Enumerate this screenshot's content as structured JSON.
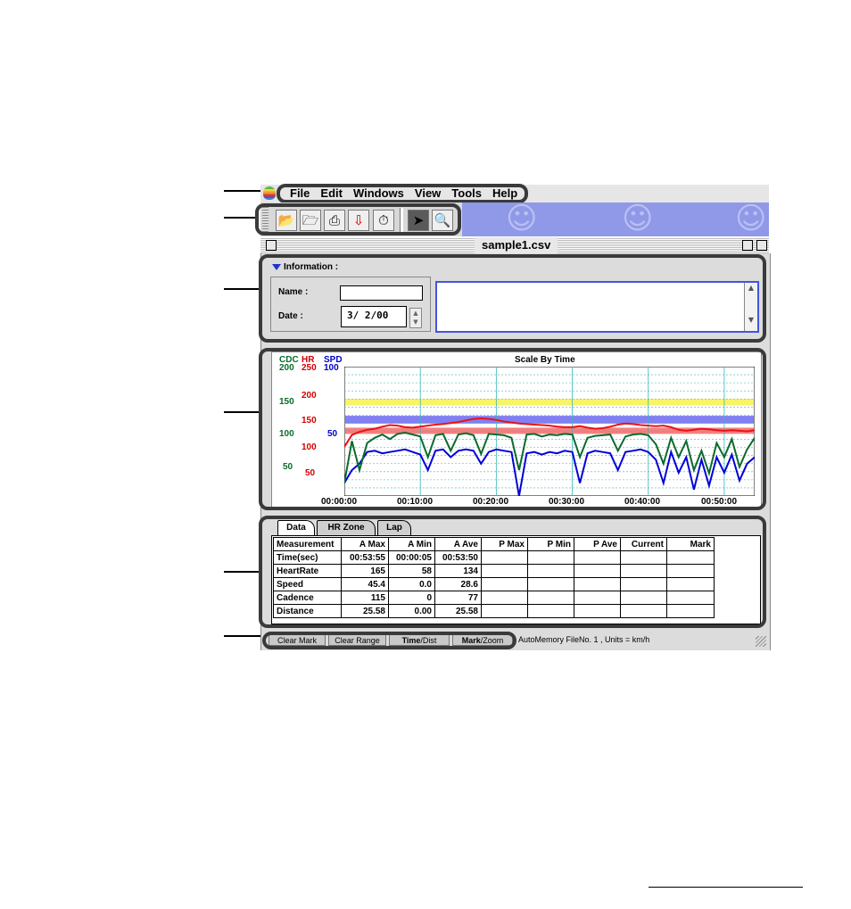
{
  "menubar": {
    "items": [
      "File",
      "Edit",
      "Windows",
      "View",
      "Tools",
      "Help"
    ]
  },
  "toolbar": {
    "buttons": [
      "open-folder-icon",
      "new-folder-icon",
      "print-icon",
      "download-icon",
      "stopwatch-icon",
      "pointer-icon",
      "zoom-icon"
    ]
  },
  "window": {
    "title": "sample1.csv"
  },
  "information": {
    "header": "Information :",
    "name_label": "Name :",
    "name_value": "",
    "date_label": "Date :",
    "date_value": "3/ 2/00"
  },
  "chart_data": {
    "type": "line",
    "title": "Scale By Time",
    "axes": {
      "cdc": {
        "label": "CDC",
        "ticks": [
          "200",
          "150",
          "100",
          "50"
        ],
        "color": "#0a6b2c"
      },
      "hr": {
        "label": "HR",
        "ticks": [
          "250",
          "200",
          "150",
          "100",
          "50"
        ],
        "color": "#d40000"
      },
      "spd": {
        "label": "SPD",
        "ticks": [
          "100",
          "50"
        ],
        "color": "#0000c8"
      }
    },
    "x_ticks": [
      "00:00:00",
      "00:10:00",
      "00:20:00",
      "00:30:00",
      "00:40:00",
      "00:50:00"
    ],
    "series": [
      {
        "name": "HR",
        "color": "#ee1111",
        "ylim": [
          0,
          250
        ],
        "x": [
          0,
          1,
          2,
          3,
          4,
          5,
          6,
          7,
          8,
          9,
          10,
          11,
          12,
          13,
          14,
          15,
          16,
          17,
          18,
          19,
          20,
          21,
          22,
          23,
          24,
          25,
          26,
          27,
          28,
          29,
          30,
          31,
          32,
          33,
          34,
          35,
          36,
          37,
          38,
          39,
          40,
          41,
          42,
          43,
          44,
          45,
          46,
          47,
          48,
          49,
          50,
          51,
          52,
          53,
          54
        ],
        "values": [
          95,
          118,
          124,
          128,
          130,
          134,
          137,
          136,
          133,
          132,
          134,
          136,
          138,
          139,
          141,
          143,
          146,
          149,
          150,
          149,
          147,
          144,
          142,
          140,
          139,
          138,
          137,
          136,
          134,
          133,
          133,
          135,
          132,
          130,
          131,
          134,
          138,
          140,
          139,
          137,
          136,
          135,
          136,
          133,
          128,
          126,
          128,
          130,
          129,
          127,
          126,
          127,
          126,
          125,
          127
        ]
      },
      {
        "name": "CDC",
        "color": "#0a6b2c",
        "ylim": [
          0,
          200
        ],
        "x": [
          0,
          1,
          2,
          3,
          4,
          5,
          6,
          7,
          8,
          9,
          10,
          11,
          12,
          13,
          14,
          15,
          16,
          17,
          18,
          19,
          20,
          21,
          22,
          23,
          24,
          25,
          26,
          27,
          28,
          29,
          30,
          31,
          32,
          33,
          34,
          35,
          36,
          37,
          38,
          39,
          40,
          41,
          42,
          43,
          44,
          45,
          46,
          47,
          48,
          49,
          50,
          51,
          52,
          53,
          54
        ],
        "values": [
          20,
          85,
          40,
          82,
          90,
          95,
          88,
          96,
          98,
          95,
          92,
          60,
          94,
          96,
          70,
          95,
          97,
          94,
          65,
          96,
          95,
          94,
          90,
          40,
          95,
          96,
          92,
          95,
          94,
          96,
          95,
          60,
          90,
          93,
          94,
          95,
          70,
          92,
          95,
          96,
          94,
          80,
          50,
          90,
          60,
          85,
          40,
          70,
          35,
          82,
          60,
          88,
          45,
          72,
          90
        ]
      },
      {
        "name": "SPD",
        "color": "#0000d8",
        "ylim": [
          0,
          100
        ],
        "x": [
          0,
          1,
          2,
          3,
          4,
          5,
          6,
          7,
          8,
          9,
          10,
          11,
          12,
          13,
          14,
          15,
          16,
          17,
          18,
          19,
          20,
          21,
          22,
          23,
          24,
          25,
          26,
          27,
          28,
          29,
          30,
          31,
          32,
          33,
          34,
          35,
          36,
          37,
          38,
          39,
          40,
          41,
          42,
          43,
          44,
          45,
          46,
          47,
          48,
          49,
          50,
          51,
          52,
          53,
          54
        ],
        "values": [
          10,
          20,
          25,
          34,
          35,
          33,
          34,
          35,
          36,
          34,
          32,
          20,
          35,
          36,
          30,
          35,
          36,
          35,
          25,
          34,
          36,
          35,
          34,
          0,
          33,
          34,
          32,
          34,
          33,
          35,
          34,
          10,
          33,
          35,
          34,
          33,
          20,
          34,
          35,
          36,
          34,
          28,
          10,
          34,
          18,
          30,
          5,
          28,
          8,
          30,
          18,
          32,
          12,
          25,
          30
        ]
      }
    ],
    "bands": [
      {
        "name": "yellow-zone",
        "color": "#f6f34a",
        "from": 175,
        "to": 188
      },
      {
        "name": "blue-zone",
        "color": "#6a6af0",
        "from": 140,
        "to": 155
      },
      {
        "name": "red-zone",
        "color": "#f06a6a",
        "from": 120,
        "to": 132
      }
    ]
  },
  "tabs": [
    "Data",
    "HR Zone",
    "Lap"
  ],
  "table": {
    "headers": [
      "Measurement",
      "A Max",
      "A Min",
      "A Ave",
      "P Max",
      "P Min",
      "P Ave",
      "Current",
      "Mark"
    ],
    "rows": [
      [
        "Time(sec)",
        "00:53:55",
        "00:00:05",
        "00:53:50",
        "",
        "",
        "",
        "",
        ""
      ],
      [
        "HeartRate",
        "165",
        "58",
        "134",
        "",
        "",
        "",
        "",
        ""
      ],
      [
        "Speed",
        "45.4",
        "0.0",
        "28.6",
        "",
        "",
        "",
        "",
        ""
      ],
      [
        "Cadence",
        "115",
        "0",
        "77",
        "",
        "",
        "",
        "",
        ""
      ],
      [
        "Distance",
        "25.58",
        "0.00",
        "25.58",
        "",
        "",
        "",
        "",
        ""
      ]
    ]
  },
  "statusbar": {
    "clear_mark": "Clear Mark",
    "clear_range": "Clear Range",
    "time_bold": "Time",
    "time_rest": "/Dist",
    "mark_bold": "Mark",
    "mark_rest": "/Zoom",
    "status_text": "AutoMemory FileNo. 1 , Units = km/h"
  }
}
